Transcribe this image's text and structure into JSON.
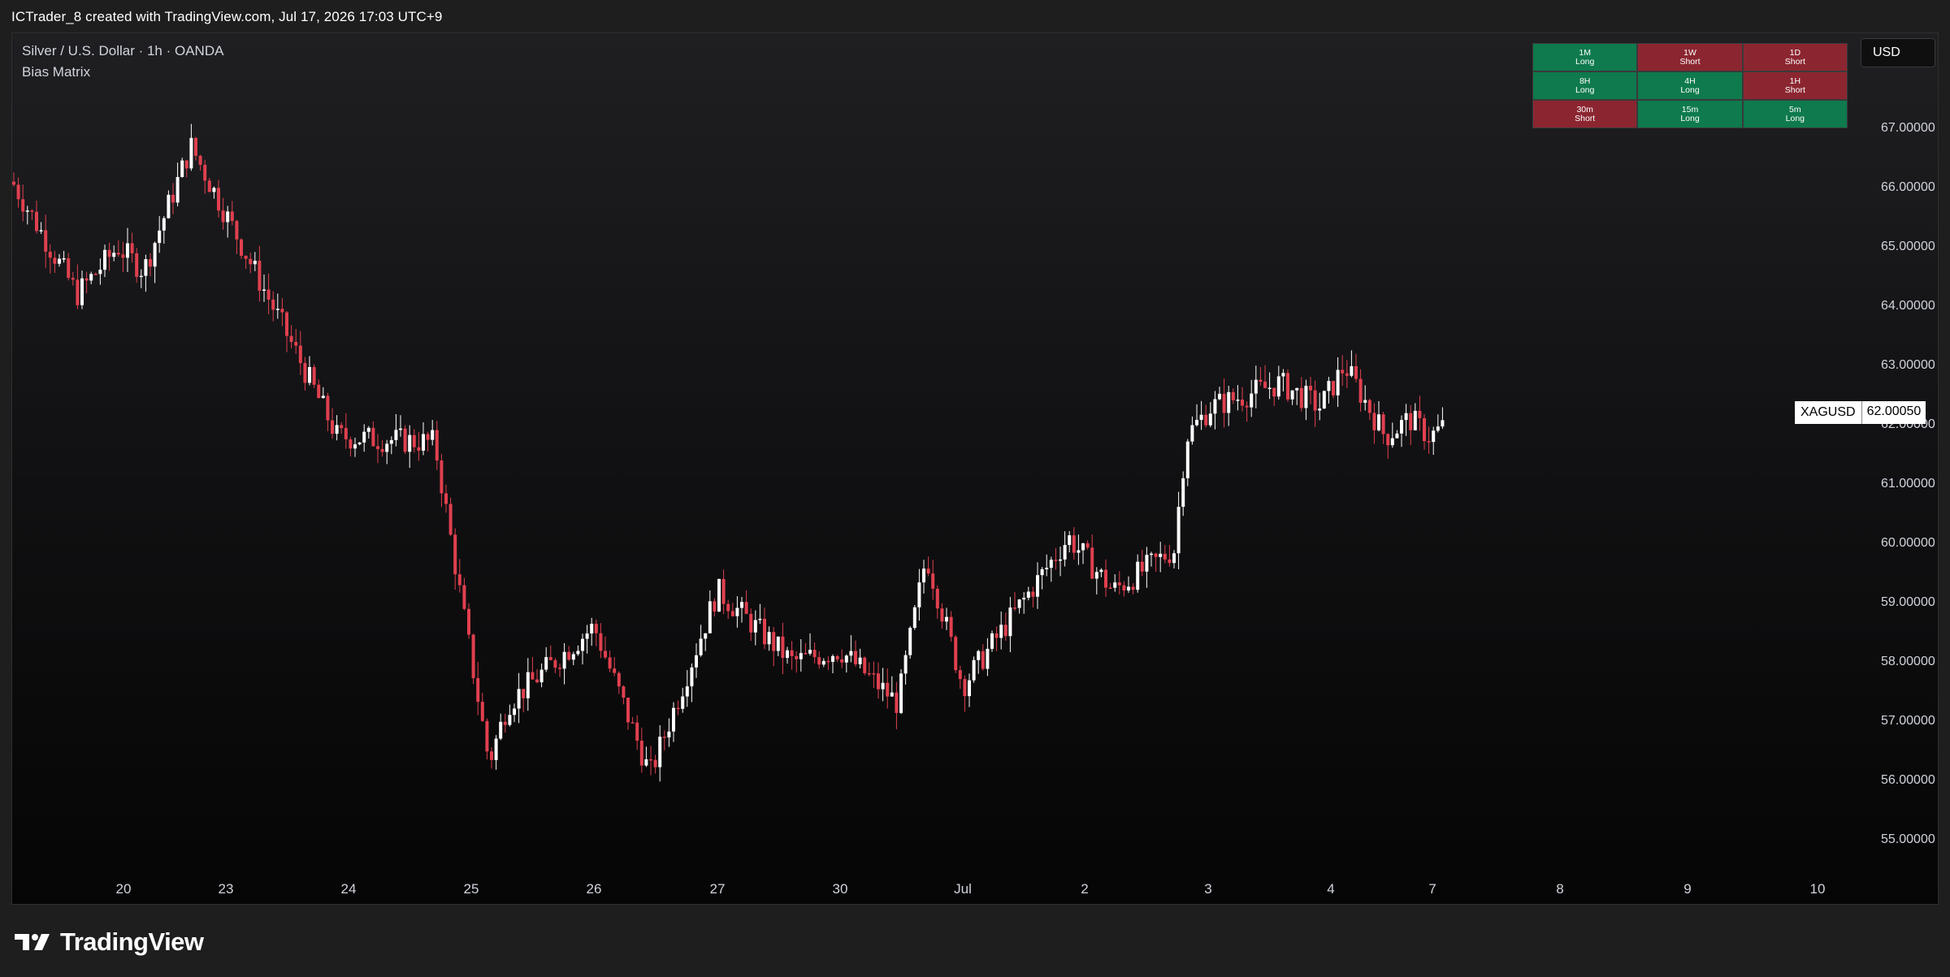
{
  "header": {
    "title": "ICTrader_8 created with TradingView.com, Jul 17, 2026 17:03 UTC+9"
  },
  "chart": {
    "symbol_info": "Silver / U.S. Dollar · 1h · OANDA",
    "indicator_label": "Bias Matrix",
    "currency": "USD",
    "price_tag": {
      "symbol": "XAGUSD",
      "value": "62.00050"
    },
    "price_ticks": [
      "67.00000",
      "66.00000",
      "65.00000",
      "64.00000",
      "63.00000",
      "62.00000",
      "61.00000",
      "60.00000",
      "59.00000",
      "58.00000",
      "57.00000",
      "56.00000",
      "55.00000"
    ],
    "time_ticks": [
      "20",
      "23",
      "24",
      "25",
      "26",
      "27",
      "30",
      "Jul",
      "2",
      "3",
      "4",
      "7",
      "8",
      "9",
      "10"
    ],
    "colors": {
      "up": "#ffffff",
      "down": "#e0404f",
      "long_cell": "#0e7a4d",
      "short_cell": "#8b2631"
    }
  },
  "bias_matrix": [
    {
      "timeframe": "1M",
      "bias": "Long"
    },
    {
      "timeframe": "1W",
      "bias": "Short"
    },
    {
      "timeframe": "1D",
      "bias": "Short"
    },
    {
      "timeframe": "8H",
      "bias": "Long"
    },
    {
      "timeframe": "4H",
      "bias": "Long"
    },
    {
      "timeframe": "1H",
      "bias": "Short"
    },
    {
      "timeframe": "30m",
      "bias": "Short"
    },
    {
      "timeframe": "15m",
      "bias": "Long"
    },
    {
      "timeframe": "5m",
      "bias": "Long"
    }
  ],
  "chart_data": {
    "type": "candlestick",
    "symbol": "XAGUSD",
    "ylim": [
      55.0,
      67.0
    ],
    "anchors": [
      {
        "x": "Jun 19",
        "y": 66.1
      },
      {
        "x": "Jun 19",
        "y": 64.2
      },
      {
        "x": "Jun 20",
        "y": 65.0
      },
      {
        "x": "Jun 20",
        "y": 64.6
      },
      {
        "x": "Jun 22",
        "y": 66.7
      },
      {
        "x": "Jun 23",
        "y": 65.2
      },
      {
        "x": "Jun 23",
        "y": 63.2
      },
      {
        "x": "Jun 24",
        "y": 61.8
      },
      {
        "x": "Jun 24",
        "y": 61.7
      },
      {
        "x": "Jun 25",
        "y": 59.0
      },
      {
        "x": "Jun 25",
        "y": 56.3
      },
      {
        "x": "Jun 25",
        "y": 57.3
      },
      {
        "x": "Jun 26",
        "y": 58.6
      },
      {
        "x": "Jun 26",
        "y": 56.1
      },
      {
        "x": "Jun 27",
        "y": 59.2
      },
      {
        "x": "Jun 29",
        "y": 58.0
      },
      {
        "x": "Jun 30",
        "y": 58.2
      },
      {
        "x": "Jun 30",
        "y": 57.3
      },
      {
        "x": "Jul 1",
        "y": 59.8
      },
      {
        "x": "Jul 1",
        "y": 57.6
      },
      {
        "x": "Jul 2",
        "y": 60.1
      },
      {
        "x": "Jul 2",
        "y": 59.2
      },
      {
        "x": "Jul 2",
        "y": 59.9
      },
      {
        "x": "Jul 3",
        "y": 61.8
      },
      {
        "x": "Jul 3",
        "y": 62.3
      },
      {
        "x": "Jul 3",
        "y": 62.7
      },
      {
        "x": "Jul 4",
        "y": 62.3
      },
      {
        "x": "Jul 4",
        "y": 63.0
      },
      {
        "x": "Jul 6",
        "y": 61.8
      },
      {
        "x": "Jul 6",
        "y": 62.1
      },
      {
        "x": "Jul 7",
        "y": 61.8
      },
      {
        "x": "Jul 7",
        "y": 62.0
      }
    ]
  }
}
